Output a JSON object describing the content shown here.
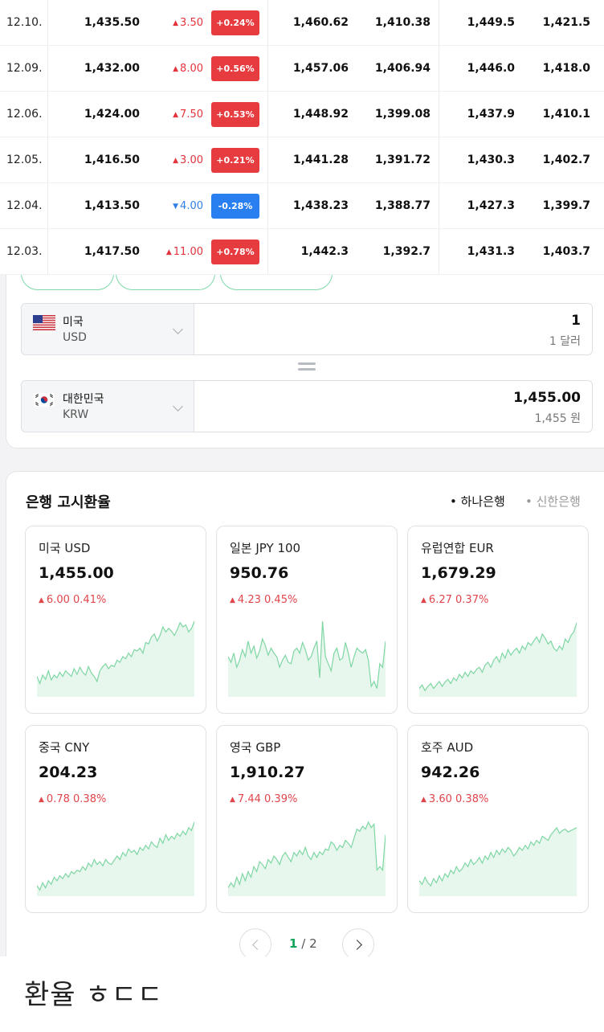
{
  "rate_table": {
    "rows": [
      {
        "date": "12.10.",
        "rate": "1,435.50",
        "change": "3.50",
        "direction": "up",
        "pct": "+0.24%",
        "buy": "1,460.62",
        "sell": "1,410.38",
        "send": "1,449.5",
        "receive": "1,421.5"
      },
      {
        "date": "12.09.",
        "rate": "1,432.00",
        "change": "8.00",
        "direction": "up",
        "pct": "+0.56%",
        "buy": "1,457.06",
        "sell": "1,406.94",
        "send": "1,446.0",
        "receive": "1,418.0"
      },
      {
        "date": "12.06.",
        "rate": "1,424.00",
        "change": "7.50",
        "direction": "up",
        "pct": "+0.53%",
        "buy": "1,448.92",
        "sell": "1,399.08",
        "send": "1,437.9",
        "receive": "1,410.1"
      },
      {
        "date": "12.05.",
        "rate": "1,416.50",
        "change": "3.00",
        "direction": "up",
        "pct": "+0.21%",
        "buy": "1,441.28",
        "sell": "1,391.72",
        "send": "1,430.3",
        "receive": "1,402.7"
      },
      {
        "date": "12.04.",
        "rate": "1,413.50",
        "change": "4.00",
        "direction": "down",
        "pct": "-0.28%",
        "buy": "1,438.23",
        "sell": "1,388.77",
        "send": "1,427.3",
        "receive": "1,399.7"
      },
      {
        "date": "12.03.",
        "rate": "1,417.50",
        "change": "11.00",
        "direction": "up",
        "pct": "+0.78%",
        "buy": "1,442.3",
        "sell": "1,392.7",
        "send": "1,431.3",
        "receive": "1,403.7"
      }
    ]
  },
  "converter": {
    "from": {
      "country": "미국",
      "code": "USD",
      "amount": "1",
      "amount_words": "1 달러",
      "flag_icon": "us-flag-icon"
    },
    "to": {
      "country": "대한민국",
      "code": "KRW",
      "amount": "1,455.00",
      "amount_words": "1,455 원",
      "flag_icon": "kr-flag-icon"
    }
  },
  "bank_rates": {
    "title": "은행 고시환율",
    "tabs": [
      {
        "label": "• 하나은행",
        "active": true
      },
      {
        "label": "• 신한은행",
        "active": false
      }
    ],
    "cards": [
      {
        "name": "미국 USD",
        "rate": "1,455.00",
        "change": "6.00",
        "pct": "0.41%",
        "spark": [
          0.22,
          0.12,
          0.24,
          0.18,
          0.3,
          0.17,
          0.24,
          0.2,
          0.28,
          0.22,
          0.3,
          0.26,
          0.22,
          0.33,
          0.25,
          0.35,
          0.28,
          0.24,
          0.36,
          0.27,
          0.22,
          0.15,
          0.3,
          0.36,
          0.4,
          0.33,
          0.38,
          0.36,
          0.45,
          0.42,
          0.5,
          0.47,
          0.55,
          0.5,
          0.6,
          0.58,
          0.62,
          0.55,
          0.7,
          0.68,
          0.78,
          0.82,
          0.72,
          0.8,
          0.92,
          0.85,
          0.9,
          0.86,
          0.8,
          0.88,
          0.98,
          0.92,
          0.95,
          0.85,
          0.9,
          1.0
        ]
      },
      {
        "name": "일본 JPY 100",
        "rate": "950.76",
        "change": "4.23",
        "pct": "0.45%",
        "spark": [
          0.5,
          0.42,
          0.55,
          0.35,
          0.45,
          0.6,
          0.5,
          0.72,
          0.55,
          0.65,
          0.48,
          0.58,
          0.75,
          0.66,
          0.52,
          0.62,
          0.55,
          0.5,
          0.35,
          0.45,
          0.52,
          0.42,
          0.4,
          0.58,
          0.62,
          0.55,
          0.7,
          0.6,
          0.45,
          0.5,
          0.62,
          0.72,
          0.2,
          1.0,
          0.5,
          0.4,
          0.3,
          0.55,
          0.62,
          0.45,
          0.48,
          0.7,
          0.55,
          0.35,
          0.5,
          0.62,
          0.58,
          0.55,
          0.6,
          0.45,
          0.08,
          0.15,
          0.05,
          0.4,
          0.35,
          0.72
        ]
      },
      {
        "name": "유럽연합 EUR",
        "rate": "1,679.29",
        "change": "6.27",
        "pct": "0.37%",
        "spark": [
          0.05,
          0.1,
          0.02,
          0.08,
          0.12,
          0.05,
          0.1,
          0.15,
          0.08,
          0.14,
          0.18,
          0.12,
          0.2,
          0.16,
          0.25,
          0.2,
          0.28,
          0.22,
          0.3,
          0.26,
          0.32,
          0.35,
          0.28,
          0.38,
          0.42,
          0.35,
          0.45,
          0.5,
          0.42,
          0.55,
          0.48,
          0.6,
          0.52,
          0.58,
          0.62,
          0.55,
          0.65,
          0.6,
          0.7,
          0.66,
          0.72,
          0.78,
          0.7,
          0.82,
          0.76,
          0.68,
          0.72,
          0.62,
          0.58,
          0.65,
          0.6,
          0.75,
          0.7,
          0.8,
          0.85,
          0.98
        ]
      },
      {
        "name": "중국 CNY",
        "rate": "204.23",
        "change": "0.78",
        "pct": "0.38%",
        "spark": [
          0.08,
          0.02,
          0.12,
          0.05,
          0.15,
          0.1,
          0.2,
          0.15,
          0.22,
          0.18,
          0.25,
          0.2,
          0.28,
          0.25,
          0.3,
          0.28,
          0.35,
          0.3,
          0.4,
          0.35,
          0.45,
          0.38,
          0.42,
          0.36,
          0.45,
          0.4,
          0.38,
          0.44,
          0.5,
          0.45,
          0.55,
          0.5,
          0.6,
          0.55,
          0.58,
          0.52,
          0.62,
          0.58,
          0.65,
          0.6,
          0.7,
          0.65,
          0.62,
          0.75,
          0.68,
          0.8,
          0.72,
          0.78,
          0.74,
          0.82,
          0.78,
          0.85,
          0.8,
          0.9,
          0.86,
          0.98
        ]
      },
      {
        "name": "영국 GBP",
        "rate": "1,910.27",
        "change": "7.44",
        "pct": "0.39%",
        "spark": [
          0.05,
          0.12,
          0.06,
          0.2,
          0.1,
          0.25,
          0.15,
          0.28,
          0.2,
          0.35,
          0.28,
          0.42,
          0.38,
          0.32,
          0.45,
          0.4,
          0.5,
          0.45,
          0.38,
          0.5,
          0.55,
          0.48,
          0.42,
          0.55,
          0.5,
          0.58,
          0.52,
          0.62,
          0.5,
          0.45,
          0.55,
          0.48,
          0.56,
          0.52,
          0.6,
          0.58,
          0.7,
          0.66,
          0.58,
          0.65,
          0.62,
          0.72,
          0.68,
          0.62,
          0.75,
          0.88,
          0.85,
          0.92,
          0.88,
          0.98,
          0.9,
          0.95,
          0.3,
          0.35,
          0.3,
          0.8
        ]
      },
      {
        "name": "호주 AUD",
        "rate": "942.26",
        "change": "3.60",
        "pct": "0.38%",
        "spark": [
          0.15,
          0.1,
          0.2,
          0.12,
          0.08,
          0.18,
          0.12,
          0.22,
          0.15,
          0.25,
          0.2,
          0.3,
          0.25,
          0.35,
          0.28,
          0.32,
          0.4,
          0.35,
          0.45,
          0.38,
          0.42,
          0.48,
          0.4,
          0.5,
          0.45,
          0.55,
          0.48,
          0.58,
          0.52,
          0.6,
          0.55,
          0.62,
          0.58,
          0.5,
          0.55,
          0.62,
          0.58,
          0.65,
          0.6,
          0.7,
          0.65,
          0.72,
          0.68,
          0.78,
          0.75,
          0.72,
          0.8,
          0.85,
          0.9,
          0.82,
          0.86,
          0.88,
          0.84,
          0.86,
          0.88,
          0.9
        ]
      }
    ],
    "pager": {
      "current": "1",
      "separator": "/",
      "total": "2"
    }
  },
  "search_text": "환율 ㅎㄷㄷ",
  "colors": {
    "up": "#e3343d",
    "down": "#2f7fe6",
    "spark_line": "#7ed6a3",
    "active_page": "#12a35a"
  }
}
